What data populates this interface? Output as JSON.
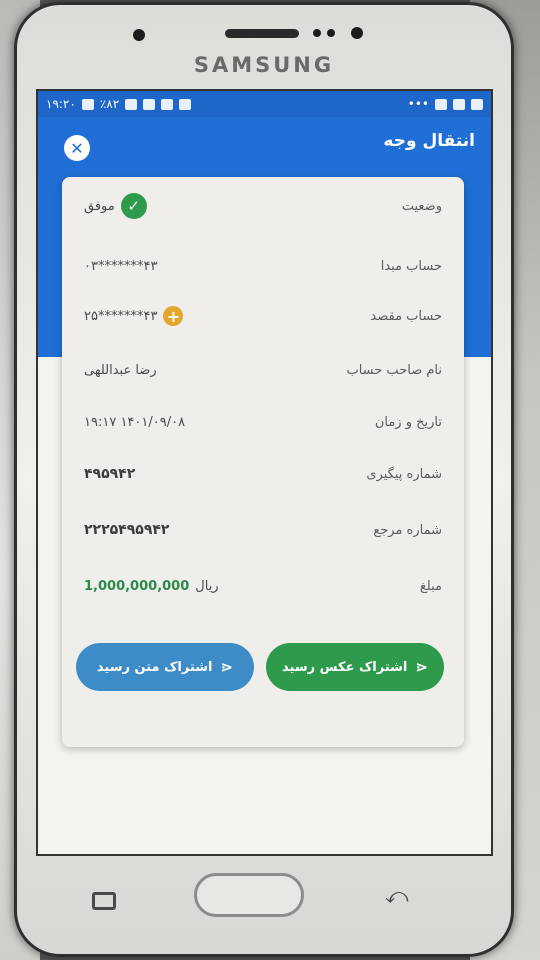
{
  "device": {
    "brand": "SAMSUNG"
  },
  "status_bar": {
    "time": "۱۹:۲۰",
    "battery": "٪۸۲"
  },
  "header": {
    "title": "انتقال وجه",
    "close_icon": "close-icon"
  },
  "receipt": {
    "rows": [
      {
        "label": "وضعیت",
        "value": "موفق",
        "icon": "check-icon"
      },
      {
        "label": "حساب مبدا",
        "value": "۴۳*******۰۳"
      },
      {
        "label": "حساب مقصد",
        "value": "۴۳*******۲۵",
        "icon": "plus-icon"
      },
      {
        "label": "نام صاحب حساب",
        "value": "رضا عبداللهی"
      },
      {
        "label": "تاریخ و زمان",
        "value": "۱۴۰۱/۰۹/۰۸  ۱۹:۱۷"
      },
      {
        "label": "شماره پیگیری",
        "value": "۴۹۵۹۴۲"
      },
      {
        "label": "شماره مرجع",
        "value": "۲۲۲۵۴۹۵۹۴۲"
      },
      {
        "label": "مبلغ",
        "amount": "1,000,000,000",
        "currency": "ریال"
      }
    ]
  },
  "actions": {
    "share_image_label": "اشتراک عکس رسید",
    "share_text_label": "اشتراک متن رسید"
  },
  "colors": {
    "header_blue": "#1f6fd6",
    "success_green": "#2e9a4c",
    "share_text_blue": "#3d8cc7",
    "amount_green": "#2e8a4a"
  }
}
